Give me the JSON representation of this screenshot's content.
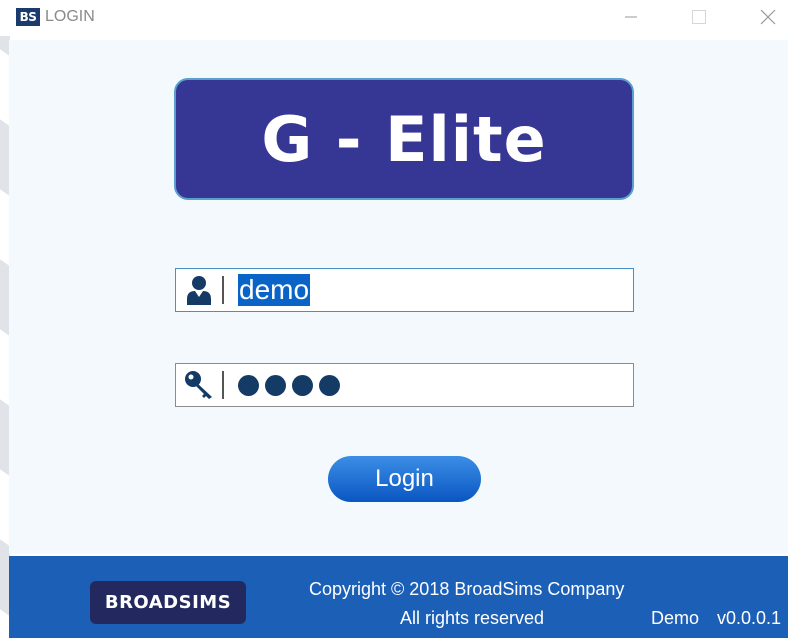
{
  "window": {
    "logo_text": "BS",
    "title": "LOGIN"
  },
  "banner": {
    "title": "G - Elite"
  },
  "login_form": {
    "username": {
      "icon": "user-icon",
      "value": "demo"
    },
    "password": {
      "icon": "key-icon",
      "masked_length": 4
    },
    "login_button_label": "Login"
  },
  "footer": {
    "brand": "BROADSIMS",
    "copyright": "Copyright © 2018 BroadSims Company",
    "rights": "All rights reserved",
    "edition": "Demo",
    "version": "v0.0.0.1"
  },
  "colors": {
    "banner_bg": "#363694",
    "accent": "#0a56c2",
    "footer_bg": "#1c5fb6",
    "brand_badge_bg": "#23295e",
    "panel_bg": "#f3f9fc"
  }
}
